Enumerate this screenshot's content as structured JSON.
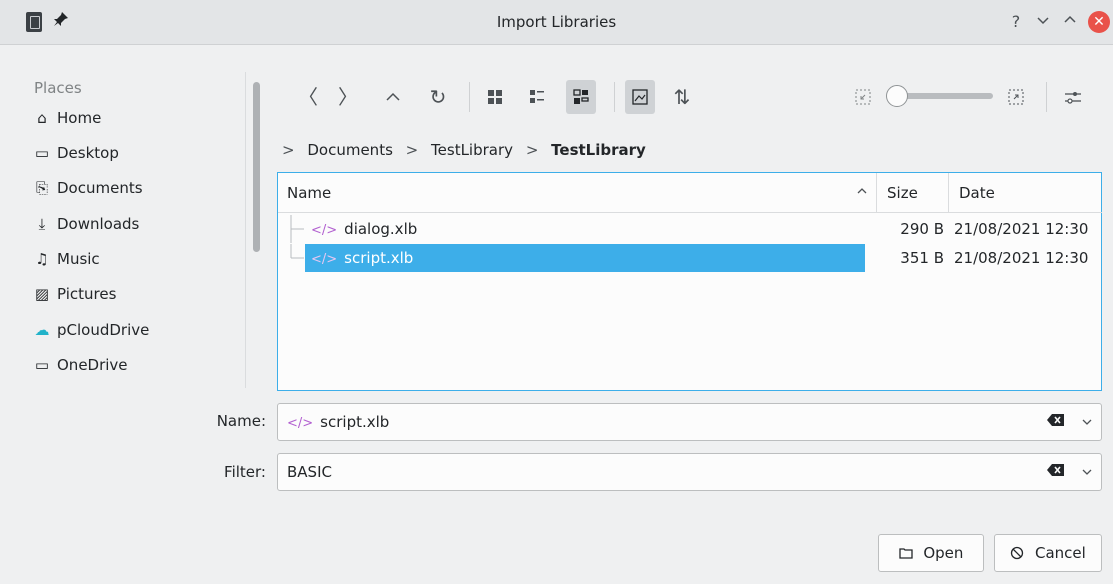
{
  "window": {
    "title": "Import Libraries",
    "help": "?",
    "minimize": "⌵",
    "maximize": "⌃",
    "close": "✕"
  },
  "places": {
    "header": "Places",
    "items": [
      {
        "label": "Home",
        "icon": "home-icon",
        "glyph": "⌂"
      },
      {
        "label": "Desktop",
        "icon": "desktop-icon",
        "glyph": "▭"
      },
      {
        "label": "Documents",
        "icon": "documents-icon",
        "glyph": "⎘"
      },
      {
        "label": "Downloads",
        "icon": "downloads-icon",
        "glyph": "⤓"
      },
      {
        "label": "Music",
        "icon": "music-icon",
        "glyph": "♫"
      },
      {
        "label": "Pictures",
        "icon": "pictures-icon",
        "glyph": "▨"
      },
      {
        "label": "pCloudDrive",
        "icon": "pcloud-icon",
        "glyph": "☁"
      },
      {
        "label": "OneDrive",
        "icon": "folder-icon",
        "glyph": "▭"
      }
    ]
  },
  "toolbar": {
    "back": "〈",
    "forward": "〉",
    "up": "⌃",
    "reload": "↻",
    "sort": "⇅",
    "options": "⫶"
  },
  "breadcrumb": {
    "sep": ">",
    "items": [
      "Documents",
      "TestLibrary"
    ],
    "current": "TestLibrary"
  },
  "filelist": {
    "columns": {
      "name": "Name",
      "size": "Size",
      "date": "Date"
    },
    "sort_glyph": "^",
    "rows": [
      {
        "name": "dialog.xlb",
        "size": "290 B",
        "date": "21/08/2021 12:30",
        "selected": false
      },
      {
        "name": "script.xlb",
        "size": "351 B",
        "date": "21/08/2021 12:30",
        "selected": true
      }
    ]
  },
  "fields": {
    "name_label": "Name:",
    "name_value": "script.xlb",
    "filter_label": "Filter:",
    "filter_value": "BASIC",
    "clear_glyph": "⌫",
    "dropdown_glyph": "⌵"
  },
  "buttons": {
    "open": "Open",
    "cancel": "Cancel"
  },
  "colors": {
    "accent": "#3daee9",
    "close": "#e9524a",
    "file_icon": "#b260d0"
  }
}
